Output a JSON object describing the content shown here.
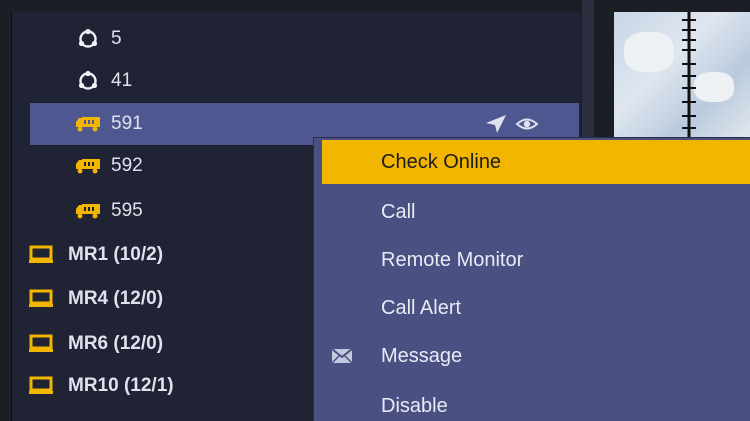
{
  "tree": {
    "items": [
      {
        "label": "5",
        "icon": "talkgroup-icon"
      },
      {
        "label": "41",
        "icon": "talkgroup-icon"
      },
      {
        "label": "591",
        "icon": "truck-icon"
      },
      {
        "label": "592",
        "icon": "truck-icon"
      },
      {
        "label": "595",
        "icon": "truck-icon"
      }
    ],
    "groups": [
      {
        "label": "MR1 (10/2)",
        "icon": "laptop-icon"
      },
      {
        "label": "MR4 (12/0)",
        "icon": "laptop-icon"
      },
      {
        "label": "MR6 (12/0)",
        "icon": "laptop-icon"
      },
      {
        "label": "MR10 (12/1)",
        "icon": "laptop-icon"
      }
    ],
    "selected_actions": [
      "locate-icon",
      "eye-icon"
    ]
  },
  "context_menu": {
    "items": [
      {
        "label": "Check Online",
        "icon": ""
      },
      {
        "label": "Call",
        "icon": ""
      },
      {
        "label": "Remote Monitor",
        "icon": ""
      },
      {
        "label": "Call Alert",
        "icon": ""
      },
      {
        "label": "Message",
        "icon": "envelope-icon"
      },
      {
        "label": "Disable",
        "icon": ""
      }
    ],
    "highlighted": "Check Online"
  },
  "colors": {
    "accent": "#f2b600",
    "selection": "#4f5791",
    "menu_bg": "#4b5083",
    "panel_bg": "#1f2333"
  }
}
